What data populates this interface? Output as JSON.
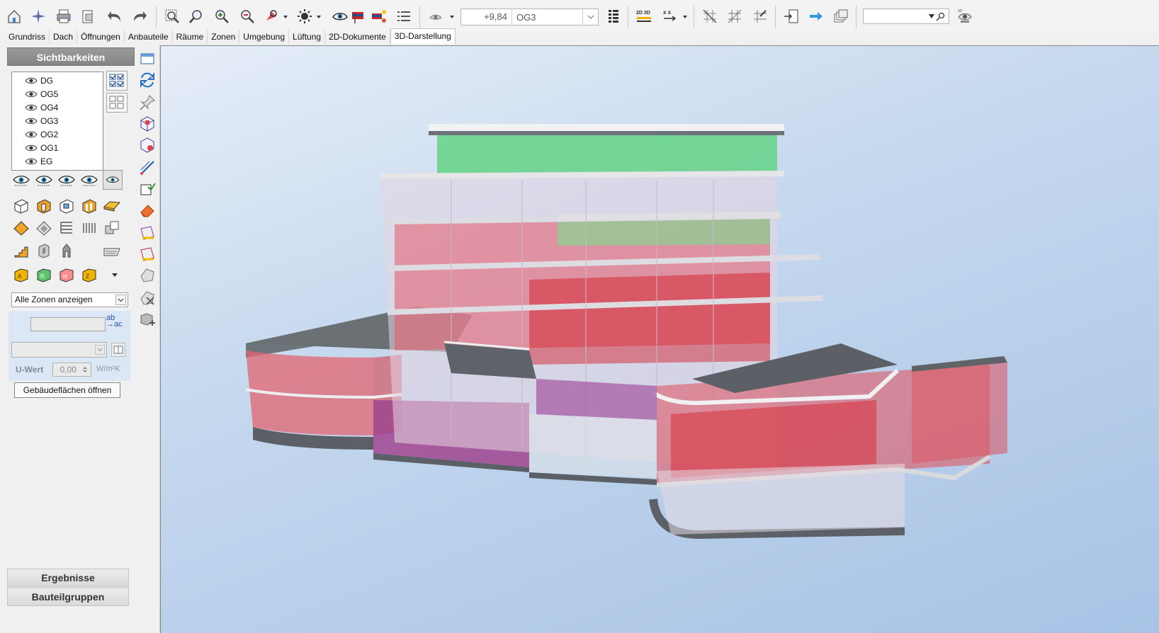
{
  "toolbar": {
    "level_value": "+9,84",
    "level_name": "OG3",
    "search_value": "",
    "icons": [
      "home-icon",
      "sparkle-icon",
      "print-icon",
      "document-icon",
      "undo-icon",
      "redo-icon",
      "zoom-window-icon",
      "zoom-pick-icon",
      "zoom-in-icon",
      "zoom-out-icon",
      "pan-icon",
      "sun-icon",
      "visibility-eye-icon",
      "flag-icon",
      "flag-bulb-icon",
      "list-icon",
      "viewpoint-icon",
      "floor-list-icon",
      "view-2d3d-icon",
      "measure-icon",
      "grid-off-icon",
      "grid-mesh-icon",
      "grid-cross-icon",
      "export-icon",
      "arrow-forward-icon",
      "stack-icon",
      "3d-eye-icon"
    ]
  },
  "tabs": [
    {
      "label": "Grundriss",
      "active": false
    },
    {
      "label": "Dach",
      "active": false
    },
    {
      "label": "Öffnungen",
      "active": false
    },
    {
      "label": "Anbauteile",
      "active": false
    },
    {
      "label": "Räume",
      "active": false
    },
    {
      "label": "Zonen",
      "active": false
    },
    {
      "label": "Umgebung",
      "active": false
    },
    {
      "label": "Lüftung",
      "active": false
    },
    {
      "label": "2D-Dokumente",
      "active": false
    },
    {
      "label": "3D-Darstellung",
      "active": true
    }
  ],
  "panel": {
    "title": "Sichtbarkeiten",
    "levels": [
      "DG",
      "OG5",
      "OG4",
      "OG3",
      "OG2",
      "OG1",
      "EG"
    ],
    "zone_filter": "Alle Zonen anzeigen",
    "zone_name": "",
    "zone_type": "",
    "uwert_label": "U-Wert",
    "uwert_value": "0,00",
    "uwert_unit": "W/m²K",
    "open_button": "Gebäudeflächen öffnen",
    "results_header": "Ergebnisse",
    "groups_header": "Bauteilgruppen"
  },
  "colors": {
    "accent": "#2f6db5",
    "zone_red": "#e0535f",
    "zone_green": "#5dcc79",
    "zone_purple": "#9a4ecb",
    "viewport_bg": "#b5cde9"
  }
}
